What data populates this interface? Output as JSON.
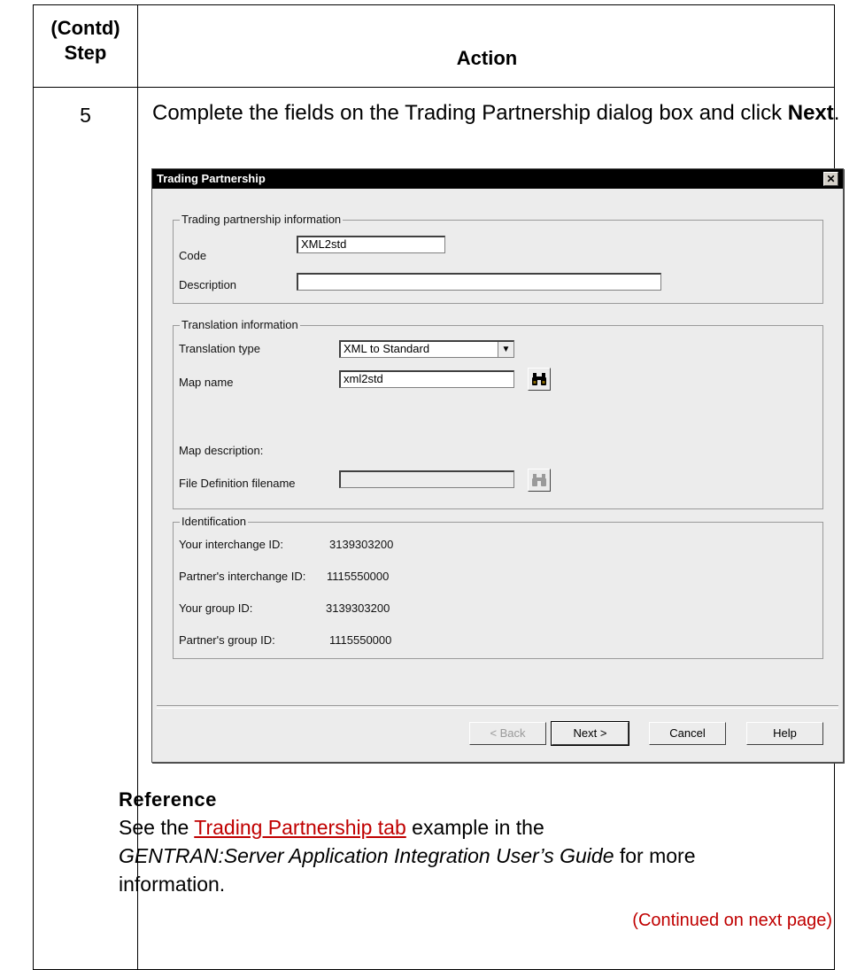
{
  "table": {
    "header_step_line1": "(Contd)",
    "header_step_line2": "Step",
    "header_action": "Action"
  },
  "row": {
    "step": "5",
    "instruction_text": "Complete the fields on the Trading Partnership dialog box and click ",
    "instruction_bold": "Next",
    "instruction_end": "."
  },
  "dialog": {
    "title": "Trading Partnership",
    "close_glyph": "✕",
    "tp_info": {
      "title": "Trading partnership information",
      "code_label": "Code",
      "code_value": "XML2std",
      "description_label": "Description",
      "description_value": ""
    },
    "translation": {
      "title": "Translation information",
      "type_label": "Translation type",
      "type_value": "XML to Standard",
      "map_name_label": "Map name",
      "map_name_value": "xml2std",
      "map_desc_label": "Map description:",
      "file_def_label": "File Definition filename",
      "file_def_value": ""
    },
    "identification": {
      "title": "Identification",
      "rows": [
        {
          "label": "Your interchange ID:",
          "value": "3139303200"
        },
        {
          "label": "Partner's interchange ID:",
          "value": "1115550000"
        },
        {
          "label": "Your group ID:",
          "value": "3139303200"
        },
        {
          "label": "Partner's group ID:",
          "value": "1115550000"
        }
      ]
    },
    "buttons": {
      "back": "< Back",
      "next": "Next >",
      "cancel": "Cancel",
      "help": "Help"
    }
  },
  "reference": {
    "heading": "Reference",
    "text_before": "See the ",
    "link": "Trading Partnership tab",
    "text_mid": " example in the ",
    "guide": "GENTRAN:Server Application Integration User’s Guide",
    "text_after": " for more information."
  },
  "continued": "(Continued on next page)"
}
